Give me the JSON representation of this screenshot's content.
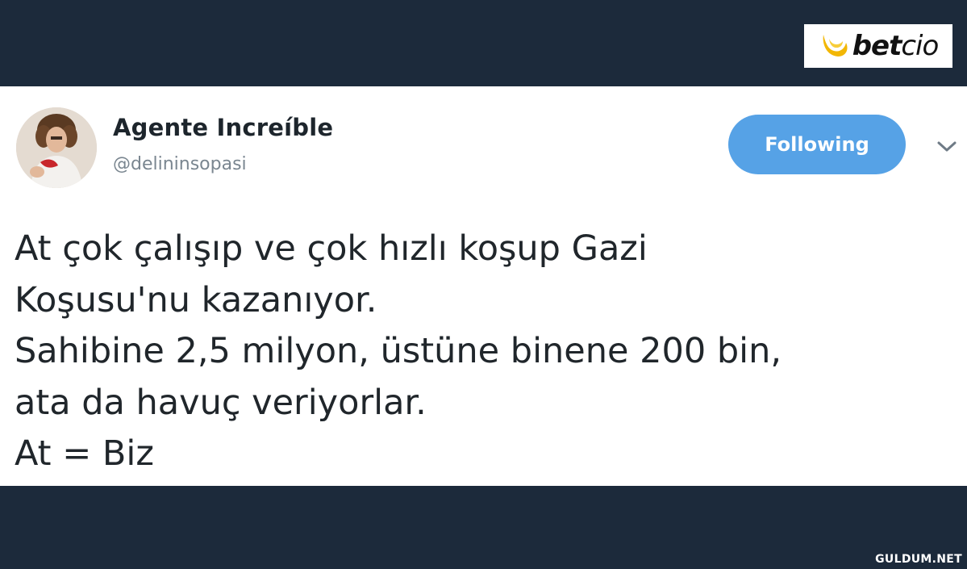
{
  "brand": {
    "logo_text_bold": "bet",
    "logo_text_light": "cio",
    "logo_color": "#f2b705"
  },
  "tweet": {
    "display_name": "Agente Increíble",
    "handle": "@delininsopasi",
    "follow_button_label": "Following",
    "follow_button_color": "#56a2e6",
    "menu_icon": "chevron-down-icon",
    "text_lines": [
      "At çok çalışıp ve çok hızlı koşup Gazi",
      "Koşusu'nu kazanıyor.",
      "Sahibine 2,5 milyon, üstüne binene 200 bin,",
      "ata da havuç veriyorlar.",
      "At = Biz"
    ]
  },
  "colors": {
    "background_dark": "#1c2a3b",
    "card_background": "#ffffff",
    "text_primary": "#20262b",
    "text_secondary": "#7a8690"
  },
  "watermark": "GULDUM.NET"
}
